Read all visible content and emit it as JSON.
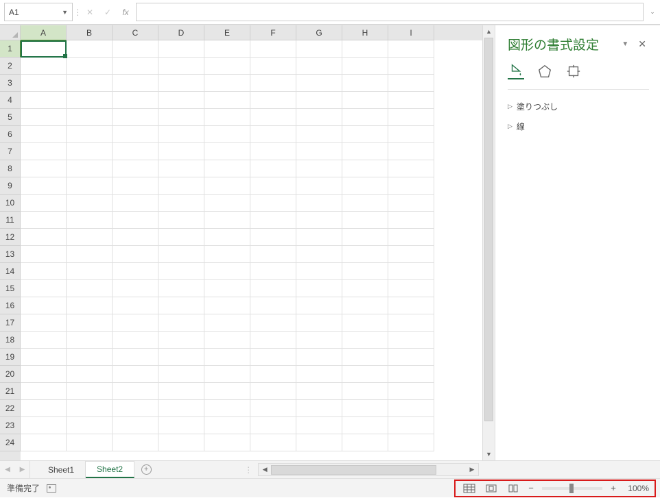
{
  "formula_bar": {
    "name_box": "A1",
    "fx_label": "fx",
    "formula_value": ""
  },
  "columns": [
    "A",
    "B",
    "C",
    "D",
    "E",
    "F",
    "G",
    "H",
    "I"
  ],
  "rows": [
    1,
    2,
    3,
    4,
    5,
    6,
    7,
    8,
    9,
    10,
    11,
    12,
    13,
    14,
    15,
    16,
    17,
    18,
    19,
    20,
    21,
    22,
    23,
    24
  ],
  "active_cell": {
    "col": "A",
    "row": 1
  },
  "sheet_tabs": {
    "tabs": [
      "Sheet1",
      "Sheet2"
    ],
    "active_index": 1
  },
  "panel": {
    "title": "図形の書式設定",
    "sections": {
      "fill": "塗りつぶし",
      "line": "線"
    }
  },
  "status": {
    "ready": "準備完了",
    "zoom": "100%"
  }
}
